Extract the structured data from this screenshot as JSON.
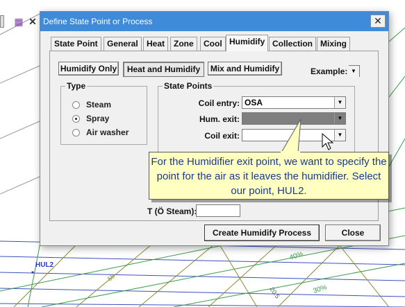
{
  "toolbar": {
    "chart_icon": "chart-icon",
    "close_icon": "close-icon"
  },
  "chart": {
    "point_label": "HUL2",
    "rh_labels": [
      "40%",
      "30%"
    ],
    "other_labels": [
      "55",
      "20.5"
    ]
  },
  "dialog": {
    "title": "Define State Point or Process",
    "close_glyph": "✕",
    "tabs": [
      "State Point",
      "General",
      "Heat",
      "Zone",
      "Cool",
      "Humidify",
      "Collection",
      "Mixing"
    ],
    "active_tab": "Humidify",
    "mode_buttons": [
      "Humidify Only",
      "Heat and Humidify",
      "Mix and Humidify"
    ],
    "pressed_mode": "Heat and Humidify",
    "example_label": "Example:",
    "type_group": {
      "label": "Type",
      "options": [
        "Steam",
        "Spray",
        "Air washer"
      ],
      "selected": "Spray"
    },
    "state_points": {
      "label": "State Points",
      "coil_entry_label": "Coil entry:",
      "coil_entry_value": "OSA",
      "hum_exit_label": "Hum. exit:",
      "hum_exit_value": "",
      "coil_exit_label": "Coil exit:",
      "coil_exit_value": ""
    },
    "hidden_label": "T (Ö Steam):",
    "create_button": "Create Humidify Process",
    "close_button": "Close"
  },
  "callout": {
    "text": "For the Humidifier exit point, we want to specify the point for the air as it leaves the humidifier.  Select our point, HUL2."
  },
  "colors": {
    "titlebar": "#3f8bd9",
    "callout_bg": "#ffffc2",
    "callout_text": "#1a3a8a",
    "grid_blue": "#3a50c0",
    "grid_olive": "#8a8a30",
    "grid_green": "#3a9a4a"
  }
}
